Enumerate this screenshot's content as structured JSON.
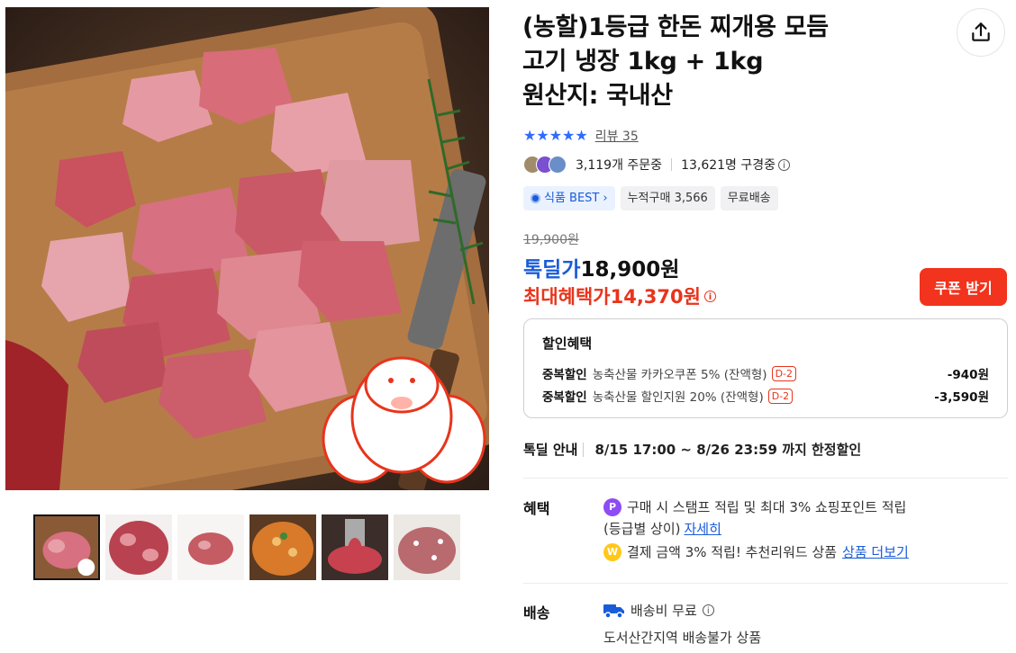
{
  "product": {
    "title_lines": [
      "(농할)1등급 한돈 찌개용 모듬",
      "고기 냉장 1kg + 1kg",
      "원산지: 국내산"
    ],
    "rating_stars": 5,
    "review_label": "리뷰 35",
    "orders_label": "3,119개 주문중",
    "viewers_label": "13,621명 구경중",
    "badges": [
      "식품 BEST",
      "누적구매 3,566",
      "무료배송"
    ]
  },
  "price": {
    "original": "19,900원",
    "deal_label": "톡딜가",
    "deal_price": "18,900원",
    "max_label": "최대혜택가",
    "max_price": "14,370원",
    "coupon_button": "쿠폰 받기"
  },
  "discounts": {
    "title": "할인혜택",
    "items": [
      {
        "type": "중복할인",
        "name": "농축산물 카카오쿠폰 5% (잔액형)",
        "dday": "D-2",
        "amount": "-940원"
      },
      {
        "type": "중복할인",
        "name": "농축산물 할인지원 20% (잔액형)",
        "dday": "D-2",
        "amount": "-3,590원"
      }
    ]
  },
  "notice": {
    "label": "톡딜 안내",
    "text": "8/15 17:00 ~ 8/26 23:59 까지 한정할인"
  },
  "benefits": {
    "label": "혜택",
    "line1": "구매 시 스탬프 적립 및 최대 3% 쇼핑포인트 적립",
    "line2": "(등급별 상이)",
    "line2_link": "자세히",
    "line3": "결제 금액 3% 적립! 추천리워드 상품",
    "line3_link": "상품 더보기",
    "coin1": "P",
    "coin2": "W"
  },
  "shipping": {
    "label": "배송",
    "fee": "배송비 무료",
    "note": "도서산간지역 배송불가 상품"
  },
  "colors": {
    "accent_blue": "#1a5cd8",
    "accent_red": "#e8341c",
    "coupon_red": "#f2331d"
  },
  "icons": [
    "share-icon",
    "star-icon",
    "info-icon",
    "best-badge-icon",
    "truck-icon",
    "point-coin-icon",
    "won-coin-icon"
  ]
}
